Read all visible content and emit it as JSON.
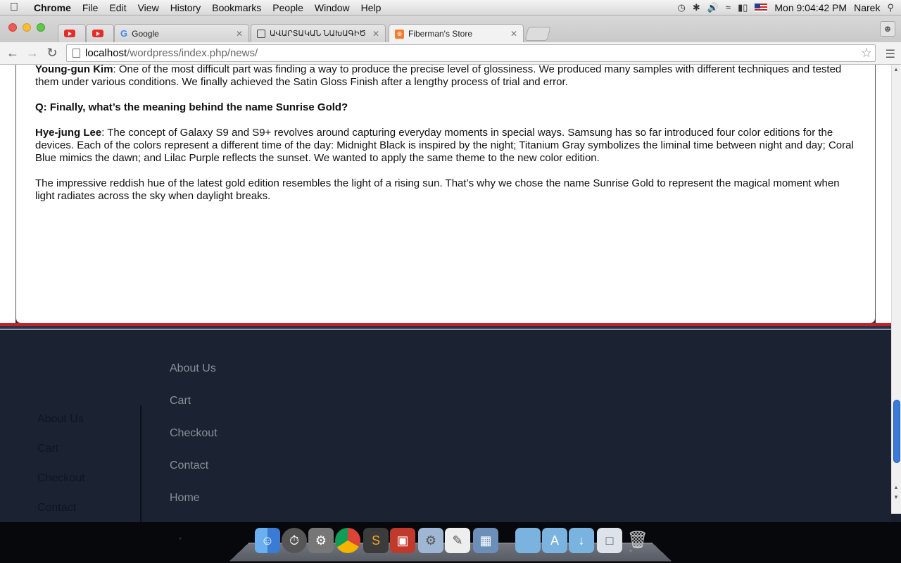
{
  "menubar": {
    "apple": "",
    "items": [
      "Chrome",
      "File",
      "Edit",
      "View",
      "History",
      "Bookmarks",
      "People",
      "Window",
      "Help"
    ],
    "clock": "Mon 9:04:42 PM",
    "user": "Narek"
  },
  "tabs": [
    {
      "title": "",
      "favicon": "youtube-icon"
    },
    {
      "title": "",
      "favicon": "youtube-icon"
    },
    {
      "title": "Google",
      "favicon": "google-icon"
    },
    {
      "title": "ԱՎԱՐՏԱԿԱՆ ՆԱԽԱԳԻԾ",
      "favicon": "contact-card-icon"
    },
    {
      "title": "Fiberman's Store",
      "favicon": "xampp-icon"
    }
  ],
  "toolbar": {
    "url_host": "localhost",
    "url_path": "/wordpress/index.php/news/"
  },
  "article": {
    "p1_name": "Young-gun Kim",
    "p1_text": ": One of the most difficult part was finding a way to produce the precise level of glossiness. We produced many samples with different techniques and tested them under various conditions. We finally achieved the Satin Gloss Finish after a lengthy process of trial and error.",
    "question": "Q: Finally, what’s the meaning behind the name Sunrise Gold?",
    "p2_name": "Hye-jung Lee",
    "p2_text": ": The concept of Galaxy S9 and S9+ revolves around capturing everyday moments in special ways. Samsung has so far introduced four color editions for the devices. Each of the colors represent a different time of the day: Midnight Black is inspired by the night; Titanium Gray symbolizes the liminal time between night and day; Coral Blue mimics the dawn; and Lilac Purple reflects the sunset. We wanted to apply the same theme to the new color edition.",
    "p3_text": "The impressive reddish hue of the latest gold edition resembles the light of a rising sun. That’s why we chose the name Sunrise Gold to represent the magical moment when light radiates across the sky when daylight breaks."
  },
  "footer": {
    "left_links": [
      "About Us",
      "Cart",
      "Checkout",
      "Contact"
    ],
    "right_links": [
      "About Us",
      "Cart",
      "Checkout",
      "Contact",
      "Home"
    ]
  },
  "colors": {
    "accent_red": "#c8202a",
    "footer_bg": "#1b2232"
  }
}
